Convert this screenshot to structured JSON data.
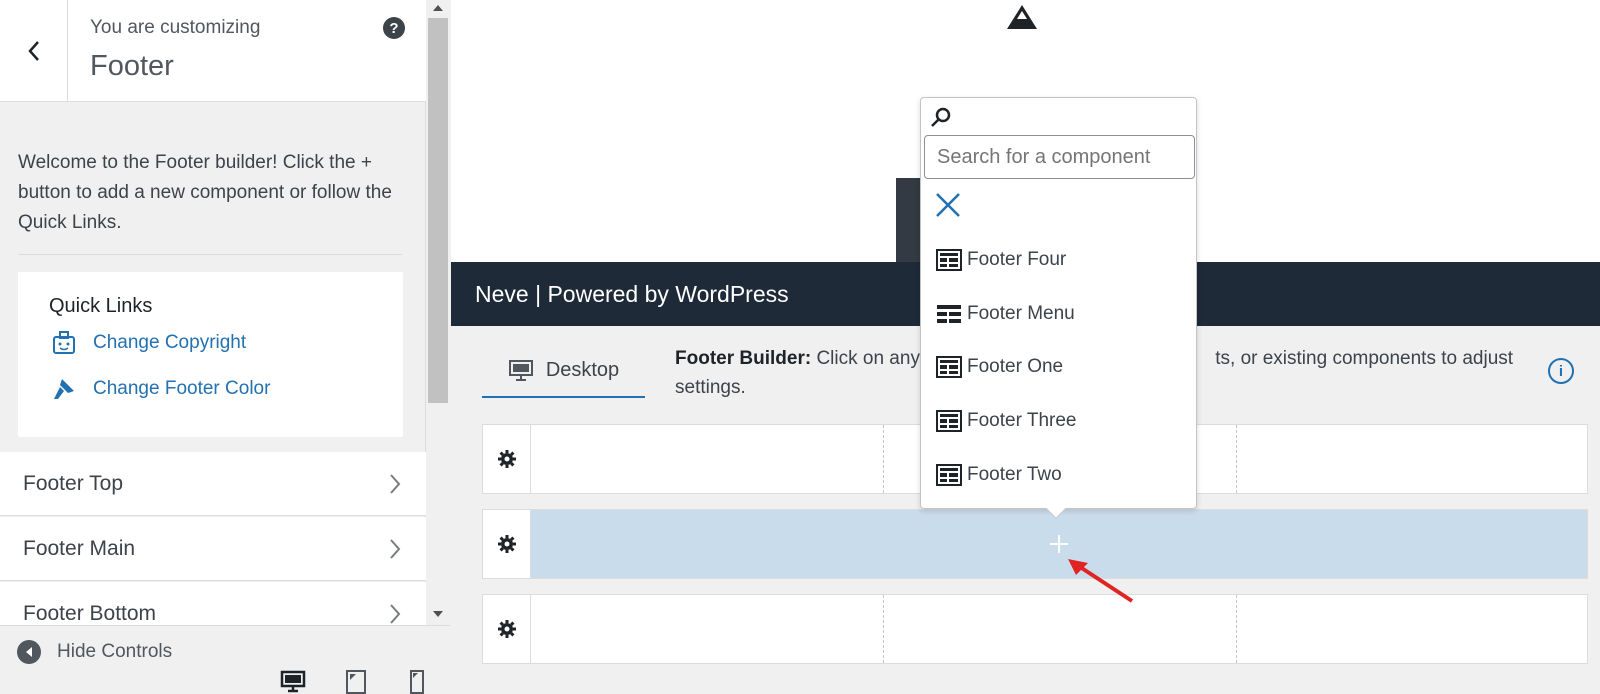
{
  "sidebar": {
    "header": {
      "label": "You are customizing",
      "title": "Footer",
      "help": "?"
    },
    "welcome": "Welcome to the Footer builder! Click the + button to add a new component or follow the Quick Links.",
    "quick_links": {
      "title": "Quick Links",
      "items": [
        {
          "label": "Change Copyright",
          "icon": "copyright-icon"
        },
        {
          "label": "Change Footer Color",
          "icon": "paint-brush-icon"
        }
      ]
    },
    "sections": [
      {
        "label": "Footer Top"
      },
      {
        "label": "Footer Main"
      },
      {
        "label": "Footer Bottom"
      }
    ],
    "hide_controls": "Hide Controls",
    "devices": [
      "desktop",
      "tablet",
      "mobile"
    ]
  },
  "preview": {
    "site_footer_text": "Neve | Powered by WordPress"
  },
  "builder": {
    "tab": "Desktop",
    "title": "Footer Builder:",
    "description": "Click on any",
    "description_rest": "ts, or existing components to adjust settings."
  },
  "popover": {
    "search_placeholder": "Search for a component",
    "components": [
      "Footer Four",
      "Footer Menu",
      "Footer One",
      "Footer Three",
      "Footer Two"
    ]
  },
  "colors": {
    "accent": "#2271b1",
    "footer_bg": "#1e2a38",
    "active_row": "#c9dcec",
    "arrow": "#e02424"
  }
}
